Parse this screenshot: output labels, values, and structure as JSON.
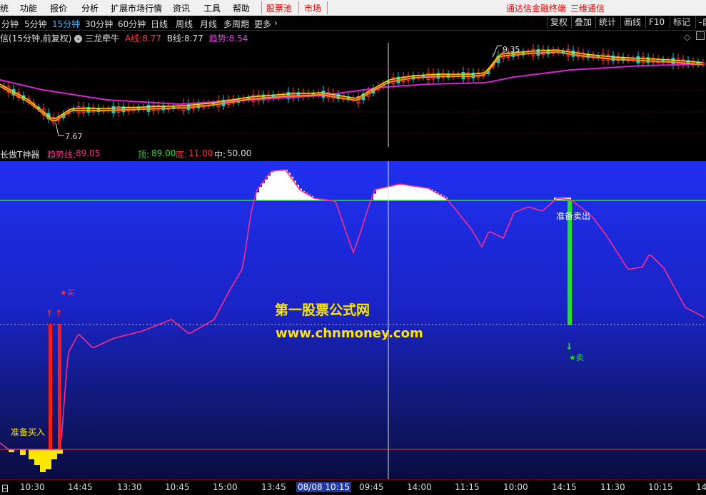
{
  "menu": {
    "items": [
      "统",
      "功能",
      "报价",
      "分析",
      "扩展市场行情",
      "资讯",
      "工具",
      "帮助"
    ],
    "pool": "股票池",
    "market": "市场",
    "brand": "通达信金融终端",
    "brand2": "三维通信"
  },
  "periods": {
    "items": [
      "分钟",
      "5分钟",
      "15分钟",
      "30分钟",
      "60分钟",
      "日线",
      "周线",
      "月线",
      "多周期",
      "更多"
    ],
    "active": "15分钟",
    "more_arrow": "›"
  },
  "toolbar": {
    "buttons": [
      "复权",
      "叠加",
      "统计",
      "画线",
      "F10",
      "标记"
    ],
    "extra": "◇",
    "extra2": "-自"
  },
  "main_pane": {
    "title": "信(15分钟,前复权)",
    "indicator": "三龙牵牛",
    "a_label": "A线:",
    "a_value": "8.77",
    "b_label": "B线:",
    "b_value": "8.77",
    "trend_label": "趋势:",
    "trend_value": "8.54",
    "high_mark": "9.35",
    "low_mark": "7.67",
    "colors": {
      "a_line": "#ffd900",
      "b_line": "#ff8c1a",
      "trend": "#d822d8",
      "up": "#ff3b3b",
      "down": "#19d0d0"
    }
  },
  "sub_pane": {
    "title": "长做T神器",
    "trend_label": "趋势线:",
    "trend_value": "89.05",
    "top_label": "顶:",
    "top_value": "89.00",
    "bottom_label": "底:",
    "bottom_value": "11.00",
    "mid_label": "中:",
    "mid_value": "50.00",
    "buy_ready": "准备买入",
    "sell_ready": "准备卖出",
    "buy_signal": "★买",
    "sell_signal": "★卖",
    "watermark_title": "第一股票公式网",
    "watermark_url": "www.chnmoney.com",
    "colors": {
      "trend": "#ff2a8a",
      "top": "#35e035",
      "bottom": "#ff3030",
      "buy": "#ff1a1a",
      "sell": "#22e022"
    }
  },
  "time_axis": {
    "ticks": [
      "日",
      "10:30",
      "14:45",
      "13:30",
      "10:45",
      "15:00",
      "13:45",
      "08/08 10:15",
      "09:45",
      "14:00",
      "11:15",
      "10:00",
      "14:15",
      "11:30",
      "10:15",
      "14"
    ],
    "highlight": "08/08 10:15"
  }
}
